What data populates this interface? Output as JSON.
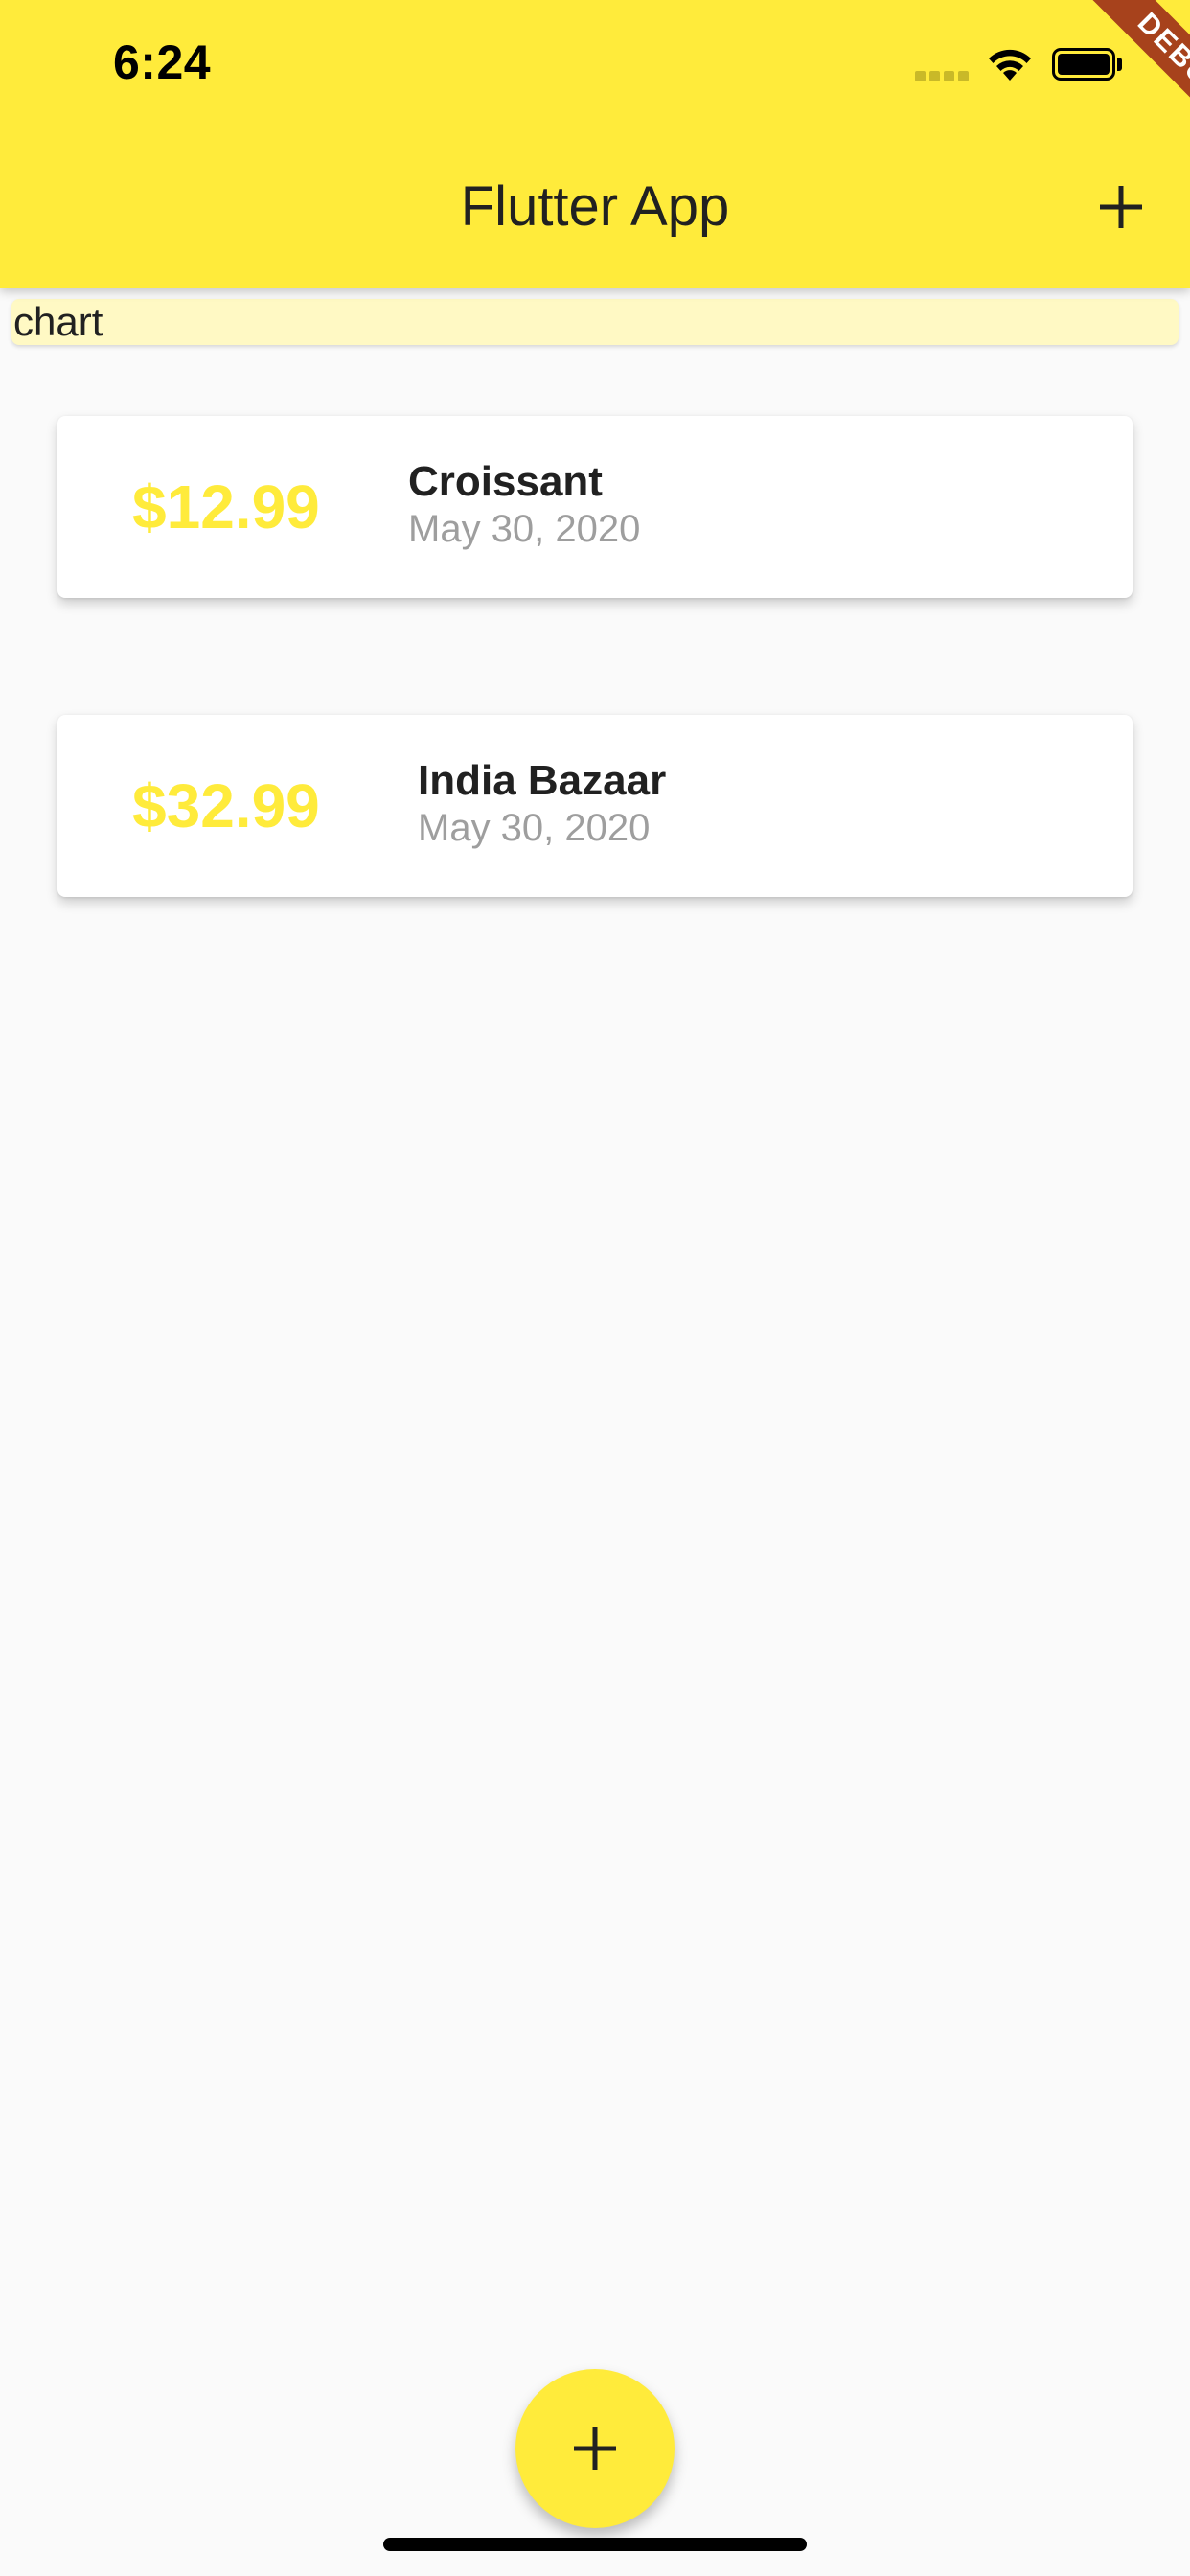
{
  "status_bar": {
    "time": "6:24"
  },
  "app_bar": {
    "title": "Flutter App",
    "add_icon": "plus-icon"
  },
  "debug_banner": {
    "label": "DEBUG"
  },
  "chart": {
    "label": "chart"
  },
  "transactions": [
    {
      "amount": "$12.99",
      "title": "Croissant",
      "date": "May 30, 2020"
    },
    {
      "amount": "$32.99",
      "title": "India Bazaar",
      "date": "May 30, 2020"
    }
  ],
  "fab": {
    "icon": "plus-icon"
  },
  "colors": {
    "primary": "#ffeb3b",
    "chart_background": "#fff9c4",
    "debug_ribbon": "#a7421c",
    "background": "#fafafa",
    "date_text": "#9e9e9e"
  }
}
